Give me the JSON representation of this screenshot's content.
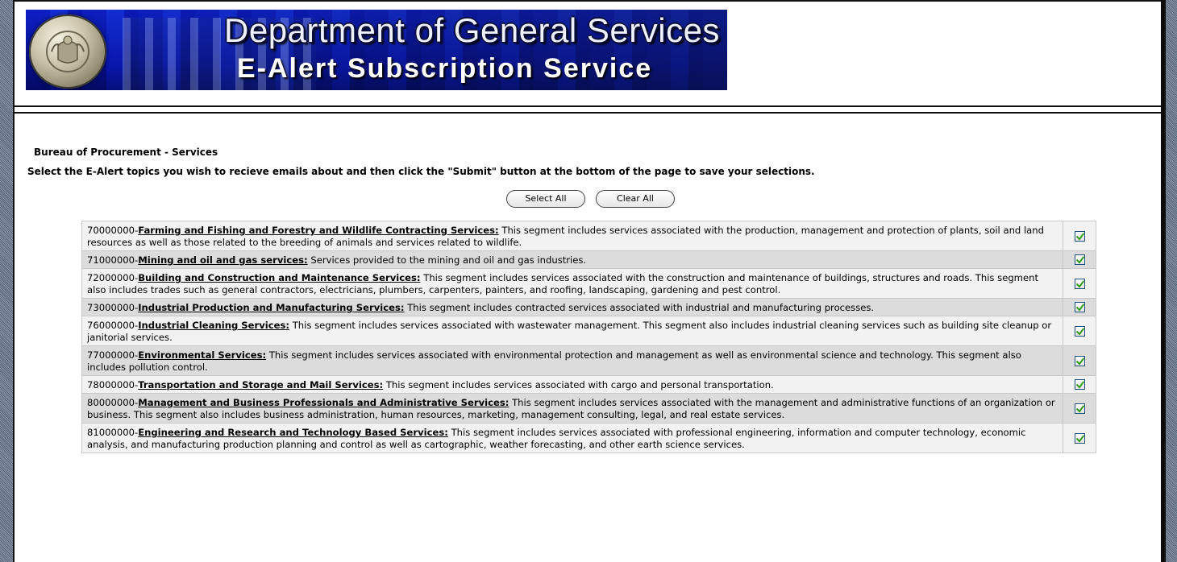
{
  "banner": {
    "title": "Department of General Services",
    "subtitle": "E-Alert Subscription Service",
    "seal_icon": "pa-state-seal-icon"
  },
  "section_title": "Bureau of Procurement -  Services",
  "instructions": "Select the E-Alert topics you wish to recieve emails about and then click the \"Submit\" button at the bottom of the page to save your selections.",
  "buttons": {
    "select_all": "Select All",
    "clear_all": "Clear All"
  },
  "colors": {
    "checkmark": "#2a9a12",
    "checkbox_border": "#1c5180"
  },
  "topics": [
    {
      "code": "70000000-",
      "name": "Farming and Fishing and Forestry and Wildlife Contracting Services:",
      "desc": " This segment includes services associated with the production, management and protection of plants, soil and land resources as well as those related to the breeding of animals and services related to wildlife.",
      "checked": true
    },
    {
      "code": "71000000-",
      "name": "Mining and oil and gas services:",
      "desc": " Services provided to the mining and oil and gas industries.",
      "checked": true
    },
    {
      "code": "72000000-",
      "name": "Building and Construction and Maintenance Services:",
      "desc": " This segment includes services associated with the construction and maintenance of buildings, structures and roads. This segment also includes trades such as general contractors, electricians, plumbers, carpenters, painters, and roofing, landscaping, gardening and pest control.",
      "checked": true
    },
    {
      "code": "73000000-",
      "name": "Industrial Production and Manufacturing Services:",
      "desc": " This segment includes contracted services associated with industrial and manufacturing processes.",
      "checked": true
    },
    {
      "code": "76000000-",
      "name": "Industrial Cleaning Services:",
      "desc": " This segment includes services associated with wastewater management. This segment also includes industrial cleaning services such as building site cleanup or janitorial services.",
      "checked": true
    },
    {
      "code": "77000000-",
      "name": "Environmental Services:",
      "desc": " This segment includes services associated with environmental protection and management as well as environmental science and technology. This segment also includes pollution control.",
      "checked": true
    },
    {
      "code": "78000000-",
      "name": "Transportation and Storage and Mail Services:",
      "desc": " This segment includes services associated with cargo and personal transportation.",
      "checked": true
    },
    {
      "code": "80000000-",
      "name": "Management and Business Professionals and Administrative Services:",
      "desc": " This segment includes services associated with the management and administrative functions of an organization or business. This segment also includes business administration, human resources, marketing, management consulting, legal, and real estate services.",
      "checked": true
    },
    {
      "code": "81000000-",
      "name": "Engineering and Research and Technology Based Services:",
      "desc": " This segment includes services associated with professional engineering, information and computer technology, economic analysis, and manufacturing production planning and control as well as cartographic, weather forecasting, and other earth science services.",
      "checked": true
    }
  ]
}
